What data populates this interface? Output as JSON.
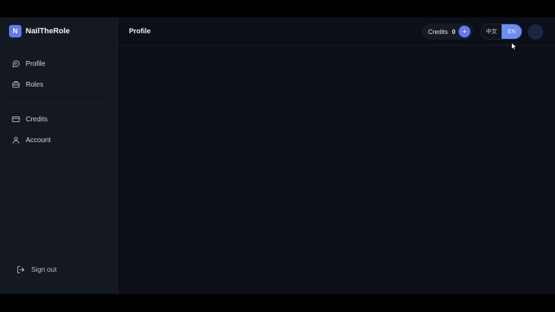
{
  "brand": {
    "logo_letter": "N",
    "name": "NailTheRole"
  },
  "sidebar": {
    "items": [
      {
        "label": "Profile",
        "icon": "chat-bubble-icon"
      },
      {
        "label": "Roles",
        "icon": "briefcase-icon"
      },
      {
        "label": "Credits",
        "icon": "credit-card-icon"
      },
      {
        "label": "Account",
        "icon": "user-icon"
      }
    ],
    "signout": {
      "label": "Sign out",
      "icon": "sign-out-icon"
    }
  },
  "header": {
    "title": "Profile",
    "credits": {
      "label": "Credits",
      "count": "0",
      "add_label": "+"
    },
    "language": {
      "options": [
        "中文",
        "EN"
      ],
      "selected": "EN"
    }
  },
  "colors": {
    "accent": "#5b7cf2",
    "sidebar_bg": "#141821",
    "main_bg": "#0c0f17"
  }
}
